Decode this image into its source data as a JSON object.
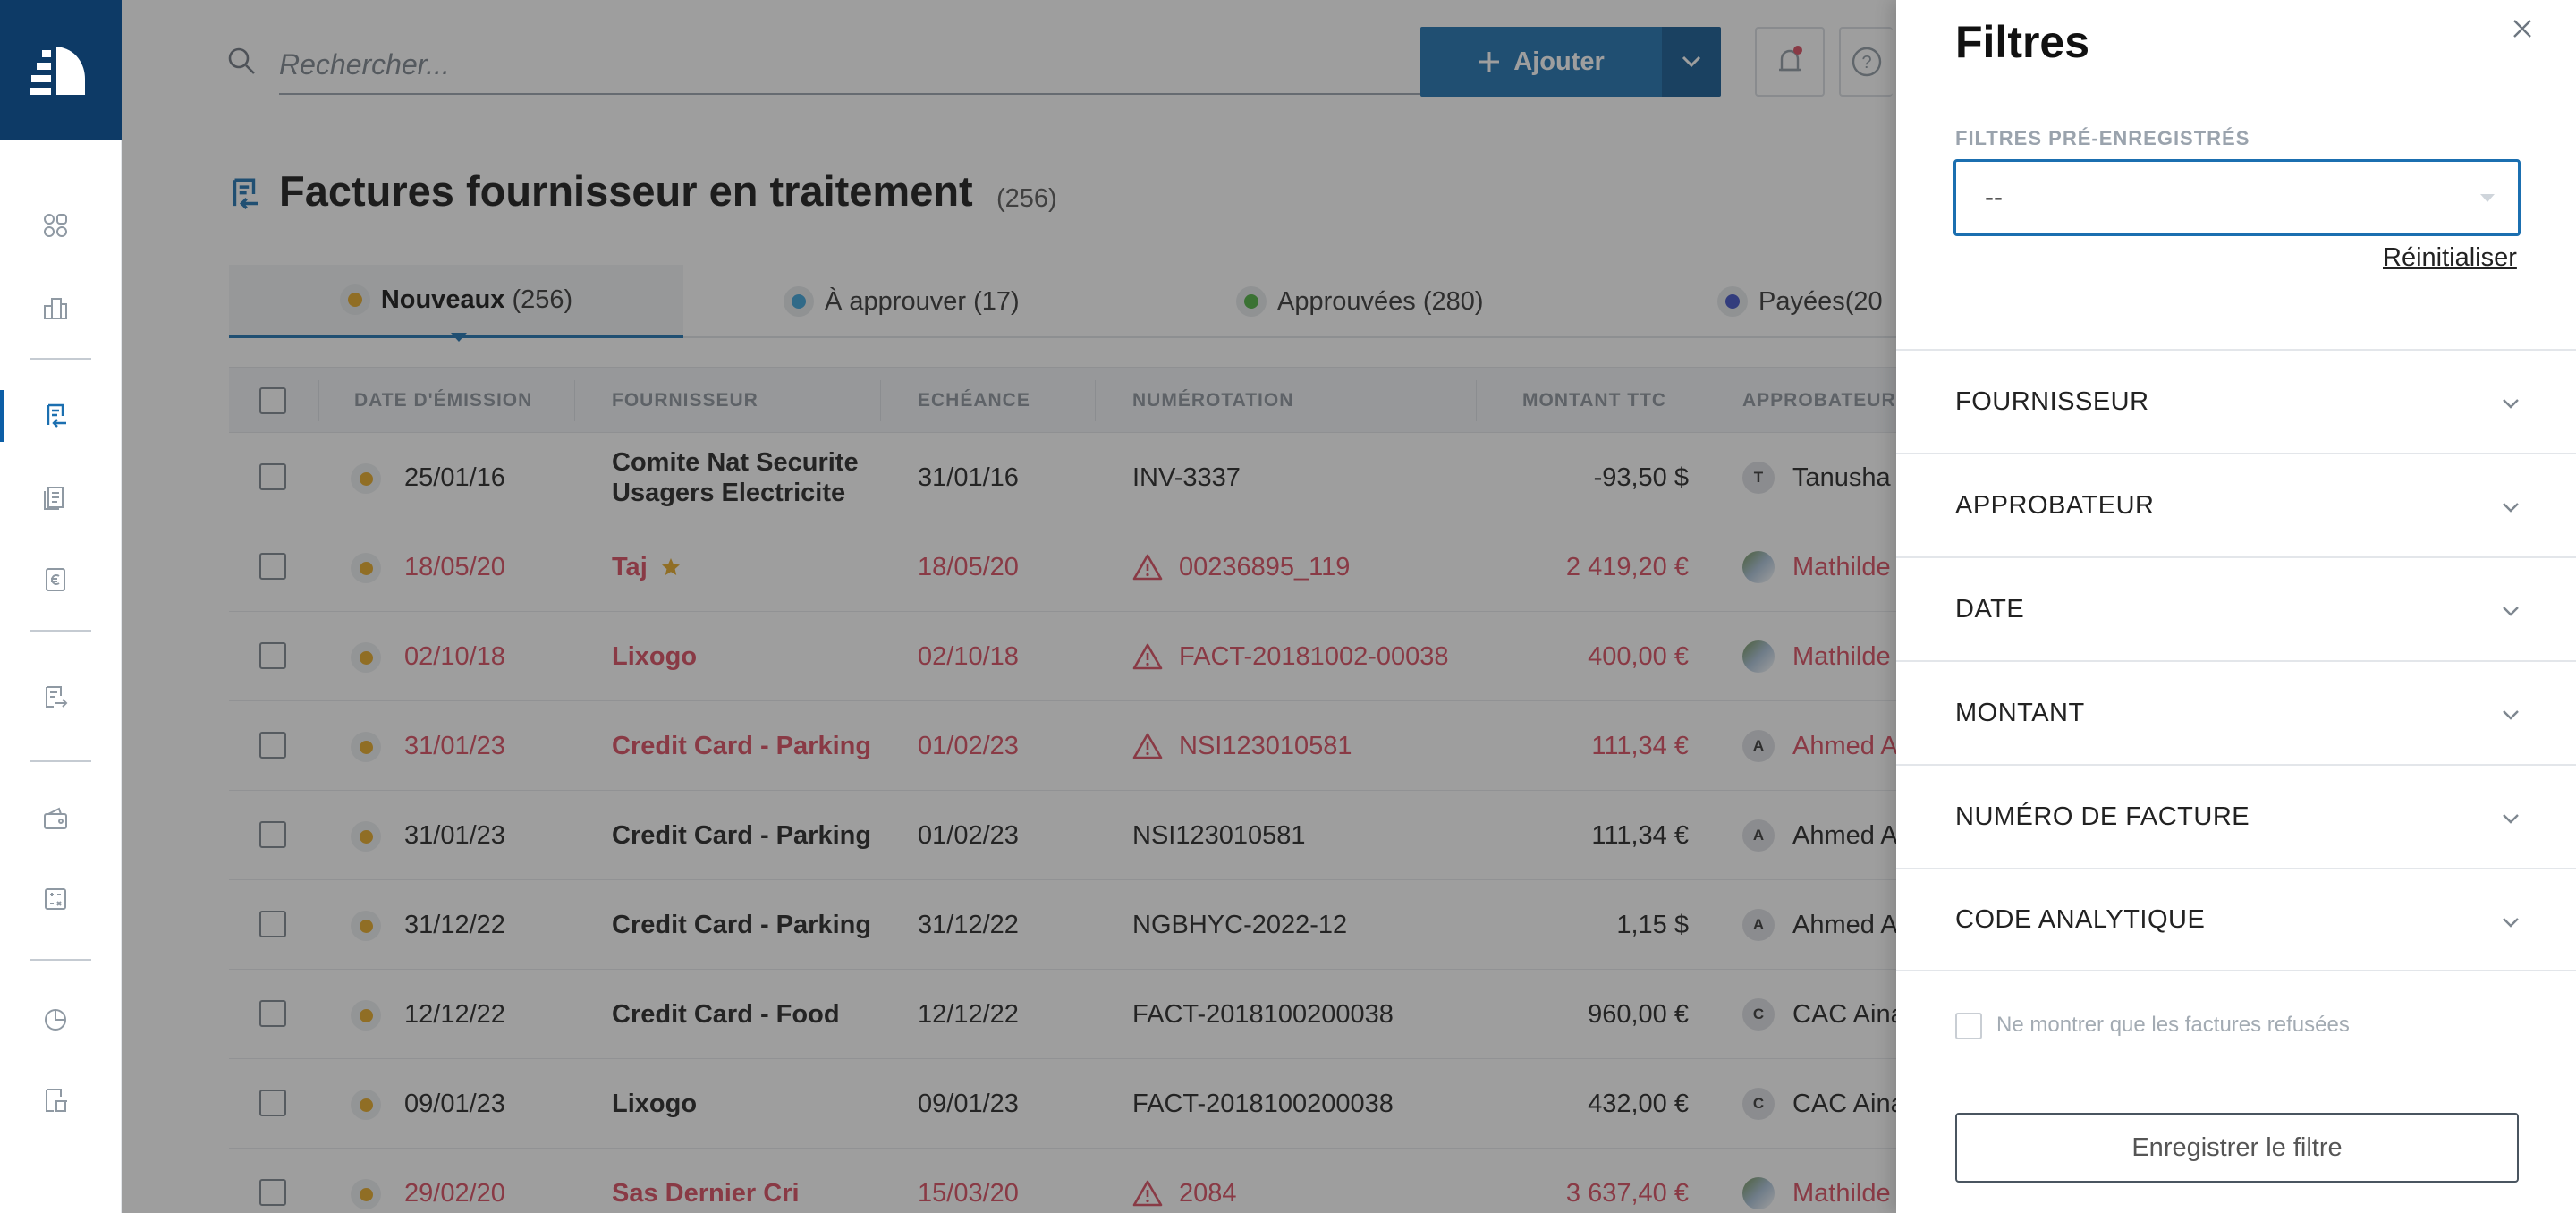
{
  "search": {
    "placeholder": "Rechercher..."
  },
  "header": {
    "add_label": "Ajouter"
  },
  "page": {
    "title": "Factures fournisseur en traitement",
    "count": "(256)"
  },
  "tabs": [
    {
      "label": "Nouveaux",
      "count": "(256)",
      "color": "#e5a824"
    },
    {
      "label": "À approuver",
      "count": "(17)",
      "color": "#3aa0d8"
    },
    {
      "label": "Approuvées",
      "count": "(280)",
      "color": "#4caf3f"
    },
    {
      "label": "Payées",
      "count": "(20",
      "color": "#3d4fc4"
    }
  ],
  "table": {
    "columns": [
      "DATE D'ÉMISSION",
      "FOURNISSEUR",
      "ECHÉANCE",
      "NUMÉROTATION",
      "MONTANT TTC",
      "APPROBATEUR"
    ],
    "rows": [
      {
        "date": "25/01/16",
        "supplier": "Comite Nat Securite Usagers Electricite",
        "due": "31/01/16",
        "number": "INV-3337",
        "amount": "-93,50 $",
        "approver_initial": "T",
        "approver": "Tanusha",
        "alert": false,
        "warning": false,
        "star": false,
        "photo": false
      },
      {
        "date": "18/05/20",
        "supplier": "Taj",
        "due": "18/05/20",
        "number": "00236895_119",
        "amount": "2 419,20 €",
        "approver_initial": "",
        "approver": "Mathilde",
        "alert": true,
        "warning": true,
        "star": true,
        "photo": true
      },
      {
        "date": "02/10/18",
        "supplier": "Lixogo",
        "due": "02/10/18",
        "number": "FACT-20181002-00038",
        "amount": "400,00 €",
        "approver_initial": "",
        "approver": "Mathilde",
        "alert": true,
        "warning": true,
        "star": false,
        "photo": true
      },
      {
        "date": "31/01/23",
        "supplier": "Credit Card - Parking",
        "due": "01/02/23",
        "number": "NSI123010581",
        "amount": "111,34 €",
        "approver_initial": "A",
        "approver": "Ahmed A",
        "alert": true,
        "warning": true,
        "star": false,
        "photo": false
      },
      {
        "date": "31/01/23",
        "supplier": "Credit Card - Parking",
        "due": "01/02/23",
        "number": "NSI123010581",
        "amount": "111,34 €",
        "approver_initial": "A",
        "approver": "Ahmed A",
        "alert": false,
        "warning": false,
        "star": false,
        "photo": false
      },
      {
        "date": "31/12/22",
        "supplier": "Credit Card - Parking",
        "due": "31/12/22",
        "number": "NGBHYC-2022-12",
        "amount": "1,15 $",
        "approver_initial": "A",
        "approver": "Ahmed A",
        "alert": false,
        "warning": false,
        "star": false,
        "photo": false
      },
      {
        "date": "12/12/22",
        "supplier": "Credit Card - Food",
        "due": "12/12/22",
        "number": "FACT-2018100200038",
        "amount": "960,00 €",
        "approver_initial": "C",
        "approver": "CAC Aina",
        "alert": false,
        "warning": false,
        "star": false,
        "photo": false
      },
      {
        "date": "09/01/23",
        "supplier": "Lixogo",
        "due": "09/01/23",
        "number": "FACT-2018100200038",
        "amount": "432,00 €",
        "approver_initial": "C",
        "approver": "CAC Aina",
        "alert": false,
        "warning": false,
        "star": false,
        "photo": false
      },
      {
        "date": "29/02/20",
        "supplier": "Sas Dernier Cri",
        "due": "15/03/20",
        "number": "2084",
        "amount": "3 637,40 €",
        "approver_initial": "",
        "approver": "Mathilde",
        "alert": true,
        "warning": true,
        "star": false,
        "photo": true
      }
    ]
  },
  "filters": {
    "title": "Filtres",
    "preset_label": "FILTRES PRÉ-ENREGISTRÉS",
    "preset_value": "--",
    "reset_label": "Réinitialiser",
    "sections": [
      "FOURNISSEUR",
      "APPROBATEUR",
      "DATE",
      "MONTANT",
      "NUMÉRO DE FACTURE",
      "CODE ANALYTIQUE"
    ],
    "refused_label": "Ne montrer que les factures refusées",
    "save_label": "Enregistrer le filtre"
  },
  "colors": {
    "brand": "#0d3a66",
    "accent": "#1b6fb0",
    "alert": "#d94a5e",
    "status_new": "#e5a824"
  }
}
